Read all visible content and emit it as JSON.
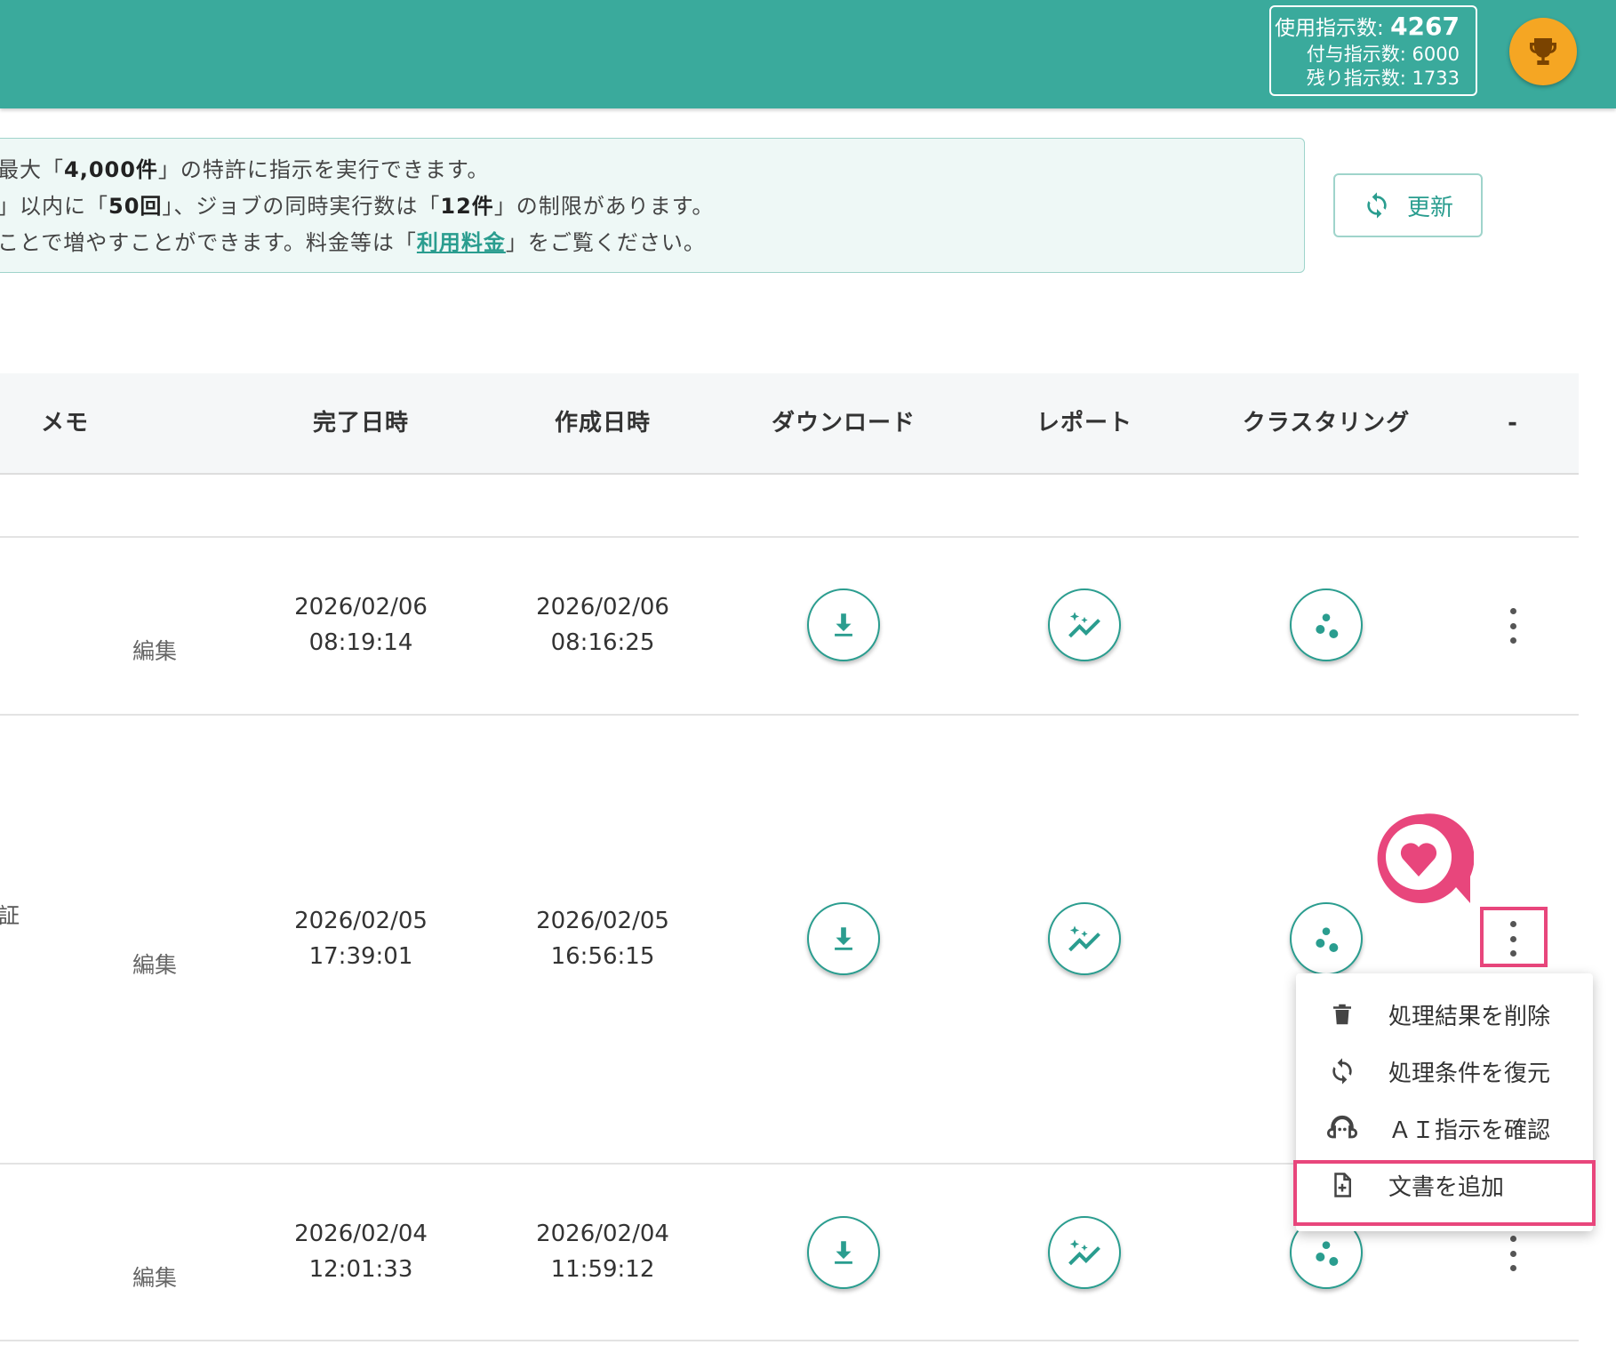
{
  "header": {
    "used_label": "使用指示数:",
    "used_value": "4267",
    "granted": "付与指示数: 6000",
    "remaining": "残り指示数: 1733",
    "trophy_icon": "trophy-icon"
  },
  "notice": {
    "line1_a": "最大「",
    "line1_b": "4,000件",
    "line1_c": "」の特許に指示を実行できます。",
    "line2_a": "」以内に「",
    "line2_b": "50回",
    "line2_c": "」、ジョブの同時実行数は「",
    "line2_d": "12件",
    "line2_e": "」の制限があります。",
    "line3_a": "ことで増やすことができます。料金等は「",
    "line3_link": "利用料金",
    "line3_c": "」をご覧ください。"
  },
  "refresh_label": "更新",
  "table": {
    "headers": {
      "memo": "メモ",
      "completed": "完了日時",
      "created": "作成日時",
      "download": "ダウンロード",
      "report": "レポート",
      "clustering": "クラスタリング",
      "more": "-"
    },
    "edit_label": "編集",
    "rows": [
      {
        "completed_date": "2026/02/06",
        "completed_time": "08:19:14",
        "created_date": "2026/02/06",
        "created_time": "08:16:25",
        "label": ""
      },
      {
        "completed_date": "2026/02/05",
        "completed_time": "17:39:01",
        "created_date": "2026/02/05",
        "created_time": "16:56:15",
        "label": "証"
      },
      {
        "completed_date": "2026/02/04",
        "completed_time": "12:01:33",
        "created_date": "2026/02/04",
        "created_time": "11:59:12",
        "label": ""
      }
    ]
  },
  "menu": {
    "items": [
      {
        "label": "処理結果を削除",
        "icon": "trash-icon"
      },
      {
        "label": "処理条件を復元",
        "icon": "restore-icon"
      },
      {
        "label": "ＡＩ指示を確認",
        "icon": "ai-head-icon"
      },
      {
        "label": "文書を追加",
        "icon": "file-add-icon"
      }
    ]
  },
  "colors": {
    "brand": "#3aaa9c",
    "accent": "#2a9d8f",
    "highlight": "#e8467c",
    "trophy": "#f5a623"
  }
}
